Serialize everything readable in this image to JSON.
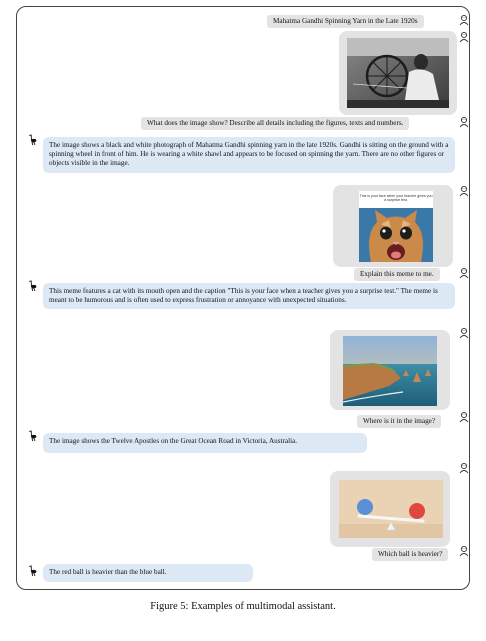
{
  "conversation": {
    "turn1": {
      "user_prompt": "Mahatma Gandhi Spinning Yarn in the Late 1920s",
      "user_question": "What does the image show? Describe all details including the figures, texts and numbers.",
      "assistant_reply": "The image shows a black and white photograph of Mahatma Gandhi spinning yarn in the late 1920s. Gandhi is sitting on the ground with a spinning wheel in front of him. He is wearing a white shawl and appears to be focused on spinning the yarn. There are no other figures or objects visible in the image."
    },
    "turn2": {
      "meme_caption": "This is your face when your teacher gives you a surprise test.",
      "user_question": "Explain this meme to me.",
      "assistant_reply": "This meme features a cat with its mouth open and the caption \"This is your face when a teacher gives you a surprise test.\" The meme is meant to be humorous and is often used to express frustration or annoyance with unexpected situations."
    },
    "turn3": {
      "user_question": "Where is it in the image?",
      "assistant_reply": "The image shows the Twelve Apostles on the Great Ocean Road in Victoria, Australia."
    },
    "turn4": {
      "user_question": "Which ball is heavier?",
      "assistant_reply": "The red ball is heavier than the blue ball."
    }
  },
  "figure_caption": "Figure 5: Examples of multimodal assistant.",
  "colors": {
    "user_bubble": "#e3e3e3",
    "assistant_bubble": "#dde8f5",
    "ball_red": "#e0483e",
    "ball_blue": "#5b8fd6"
  },
  "icons": {
    "user": "user-face-icon",
    "assistant": "ostrich-icon"
  }
}
